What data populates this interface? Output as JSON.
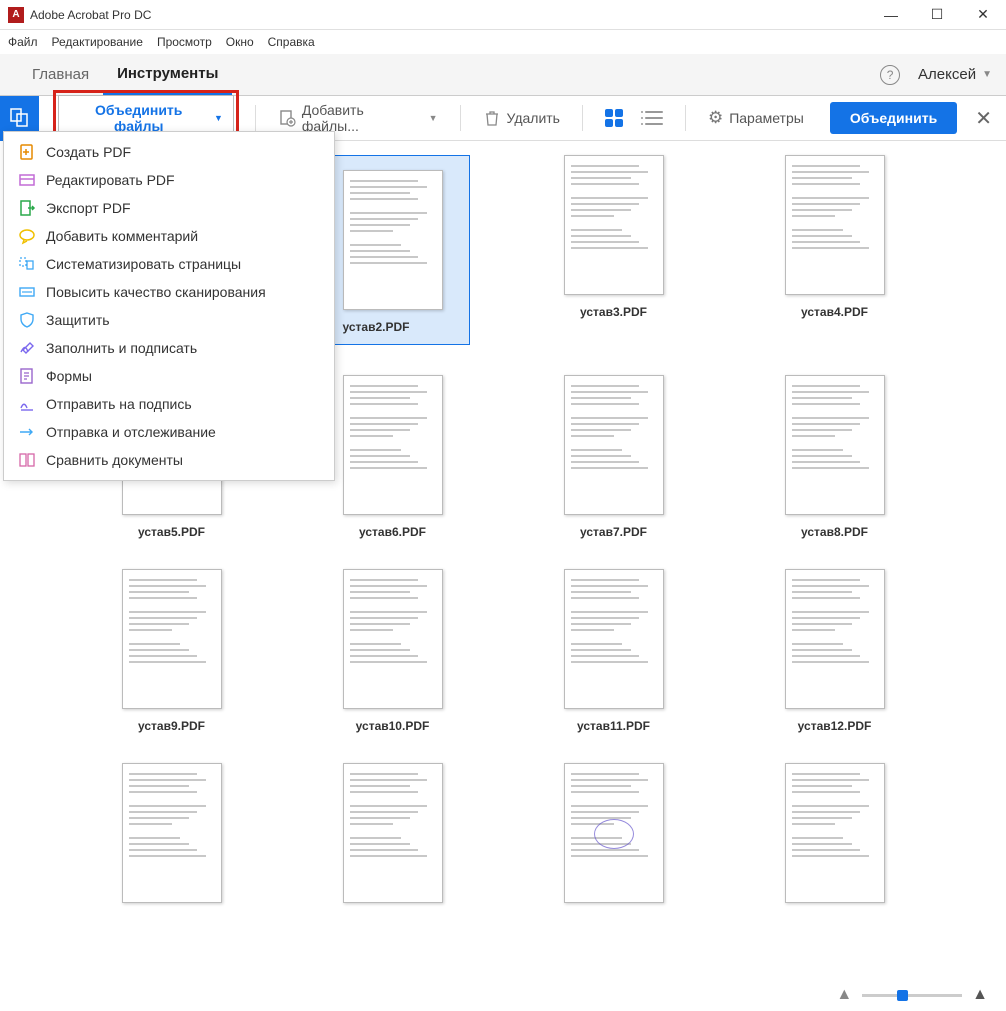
{
  "titlebar": {
    "title": "Adobe Acrobat Pro DC"
  },
  "menubar": {
    "items": [
      "Файл",
      "Редактирование",
      "Просмотр",
      "Окно",
      "Справка"
    ]
  },
  "tabs": {
    "home": "Главная",
    "tools": "Инструменты",
    "user": "Алексей"
  },
  "toolbar": {
    "combine_files": "Объединить файлы",
    "add_files": "Добавить файлы...",
    "delete": "Удалить",
    "options": "Параметры",
    "combine": "Объединить"
  },
  "dropdown": {
    "items": [
      {
        "label": "Создать PDF",
        "color": "#e68a00"
      },
      {
        "label": "Редактировать PDF",
        "color": "#c26bd6"
      },
      {
        "label": "Экспорт PDF",
        "color": "#2aa84a"
      },
      {
        "label": "Добавить комментарий",
        "color": "#f0c000"
      },
      {
        "label": "Систематизировать страницы",
        "color": "#3fa9f5"
      },
      {
        "label": "Повысить качество сканирования",
        "color": "#3fa9f5"
      },
      {
        "label": "Защитить",
        "color": "#3fa9f5"
      },
      {
        "label": "Заполнить и подписать",
        "color": "#7b68ee"
      },
      {
        "label": "Формы",
        "color": "#9966cc"
      },
      {
        "label": "Отправить на подпись",
        "color": "#7b68ee"
      },
      {
        "label": "Отправка и отслеживание",
        "color": "#3fa9f5"
      },
      {
        "label": "Сравнить документы",
        "color": "#d667a8"
      }
    ]
  },
  "files": [
    {
      "name": "устав2.PDF",
      "selected": true
    },
    {
      "name": "устав3.PDF"
    },
    {
      "name": "устав4.PDF"
    },
    {
      "name": "устав5.PDF"
    },
    {
      "name": "устав6.PDF"
    },
    {
      "name": "устав7.PDF"
    },
    {
      "name": "устав8.PDF"
    },
    {
      "name": "устав9.PDF"
    },
    {
      "name": "устав10.PDF"
    },
    {
      "name": "устав11.PDF"
    },
    {
      "name": "устав12.PDF"
    },
    {
      "name": ""
    },
    {
      "name": ""
    },
    {
      "name": "",
      "stamp": true
    },
    {
      "name": ""
    }
  ]
}
